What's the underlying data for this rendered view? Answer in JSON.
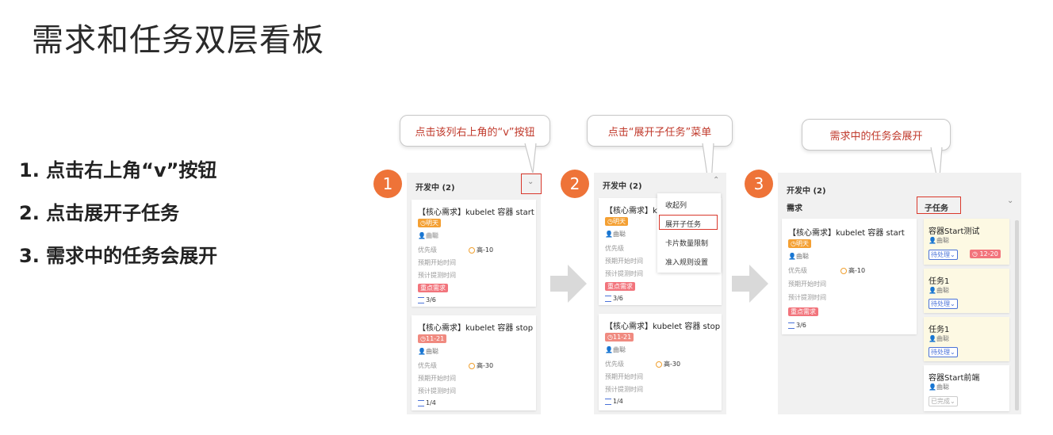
{
  "title": "需求和任务双层看板",
  "steps": [
    "1.  点击右上角“v”按钮",
    "2.  点击展开子任务",
    "3.  需求中的任务会展开"
  ],
  "callouts": {
    "c1": "点击该列右上角的“v”按钮",
    "c2": "点击“展开子任务”菜单",
    "c3": "需求中的任务会展开"
  },
  "badges": [
    "1",
    "2",
    "3"
  ],
  "column_title": "开发中 (2)",
  "cards": [
    {
      "title": "【核心需求】kubelet 容器 start",
      "title_short": "【核心需求】ku",
      "date": "明天",
      "assignee": "曲聪",
      "priority_label": "优先级",
      "priority": "高-10",
      "plan_start": "预期开始时间",
      "plan_end": "预计提测时间",
      "tag": "重点需求",
      "progress": "3/6"
    },
    {
      "title": "【核心需求】kubelet 容器 stop",
      "date": "11-21",
      "assignee": "曲聪",
      "priority_label": "优先级",
      "priority": "高-30",
      "plan_start": "预期开始时间",
      "plan_end": "预计提测时间",
      "progress": "1/4"
    }
  ],
  "menu": {
    "items": [
      "收起列",
      "展开子任务",
      "卡片数量限制",
      "准入规则设置"
    ]
  },
  "expanded": {
    "demand_label": "需求",
    "subtask_label": "子任务",
    "subtasks": [
      {
        "title": "容器Start测试",
        "assignee": "曲聪",
        "status": "待处理",
        "date": "12-20"
      },
      {
        "title": "任务1",
        "assignee": "曲聪",
        "status": "待处理"
      },
      {
        "title": "任务1",
        "assignee": "曲聪",
        "status": "待处理"
      },
      {
        "title": "容器Start前端",
        "assignee": "曲聪",
        "status": "已完成"
      }
    ]
  },
  "colors": {
    "accent_orange": "#ee7338",
    "highlight_red": "#d9382c",
    "callout_text": "#c0392b",
    "status_blue": "#4a72d8"
  }
}
